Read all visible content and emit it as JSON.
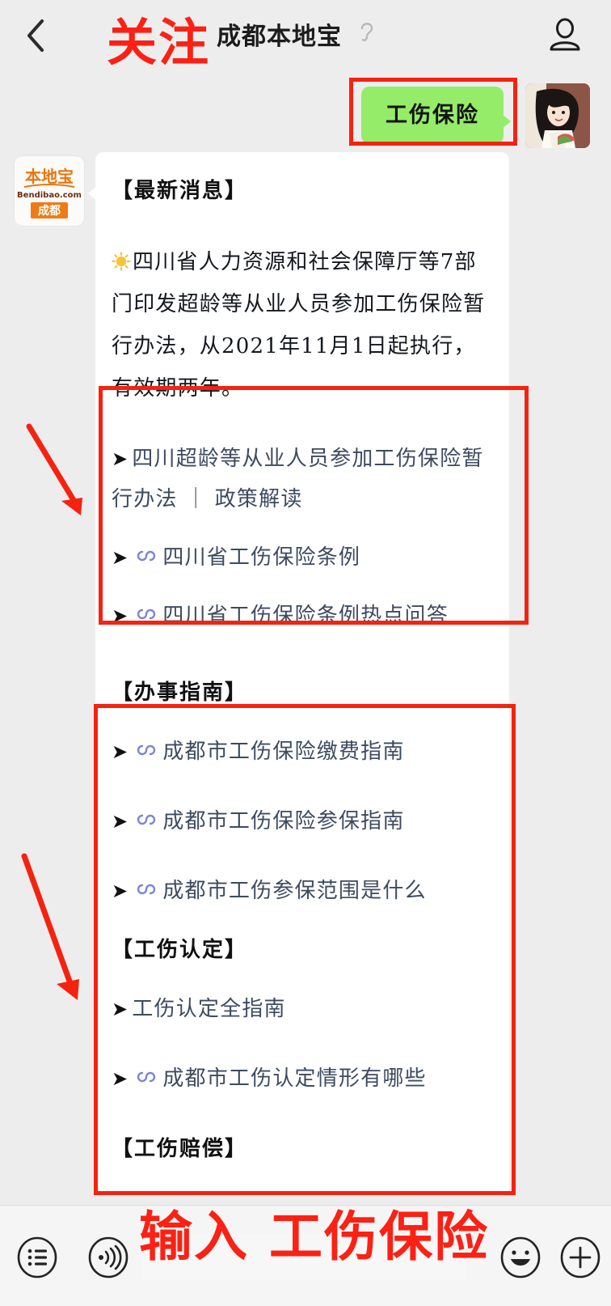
{
  "header": {
    "back_icon": "chevron-left-icon",
    "title": "成都本地宝",
    "ear_icon": "ear-listening-icon",
    "contact_icon": "contact-person-icon"
  },
  "annotations": {
    "follow_label": "关注",
    "input_label": "输入 工伤保险",
    "color": "#fb2114",
    "boxes": [
      "green-message-box",
      "links-group-1",
      "links-group-2"
    ],
    "arrows": [
      "arrow-to-links-1",
      "arrow-to-links-2"
    ]
  },
  "chat": {
    "outgoing": {
      "text": "工伤保险",
      "bubble_color": "#95EC69",
      "avatar": "user-avatar-girl"
    },
    "incoming": {
      "avatar": "bendibao-chengdu-logo",
      "avatar_text": {
        "main": "本地宝",
        "domain": "Bendibao.com",
        "city": "成都"
      },
      "bubble_color": "#ffffff",
      "section_latest_news": "【最新消息】",
      "paragraph": "四川省人力资源和社会保障厅等7部门印发超龄等从业人员参加工伤保险暂行办法，从2021年11月1日起执行，有效期两年。",
      "sun_emoji": "sun-emoji",
      "links_group_1": [
        {
          "arrow": "➤",
          "has_link_icon": false,
          "text": "四川超龄等从业人员参加工伤保险暂行办法 ｜ 政策解读"
        },
        {
          "arrow": "➤",
          "has_link_icon": true,
          "text": "四川省工伤保险条例"
        },
        {
          "arrow": "➤",
          "has_link_icon": true,
          "text": "四川省工伤保险条例热点问答"
        }
      ],
      "section_guide": "【办事指南】",
      "links_group_2": [
        {
          "arrow": "➤",
          "has_link_icon": true,
          "text": "成都市工伤保险缴费指南"
        },
        {
          "arrow": "➤",
          "has_link_icon": true,
          "text": "成都市工伤保险参保指南"
        },
        {
          "arrow": "➤",
          "has_link_icon": true,
          "text": "成都市工伤参保范围是什么"
        }
      ],
      "section_recognition": "【工伤认定】",
      "links_group_3": [
        {
          "arrow": "➤",
          "has_link_icon": false,
          "text": "工伤认定全指南"
        },
        {
          "arrow": "➤",
          "has_link_icon": true,
          "text": "成都市工伤认定情形有哪些"
        }
      ],
      "section_compensation": "【工伤赔偿】"
    }
  },
  "bottom_bar": {
    "menu_icon": "list-menu-icon",
    "voice_icon": "voice-wave-icon",
    "emoji_icon": "smiley-face-icon",
    "plus_icon": "plus-circle-icon",
    "input_placeholder": ""
  }
}
